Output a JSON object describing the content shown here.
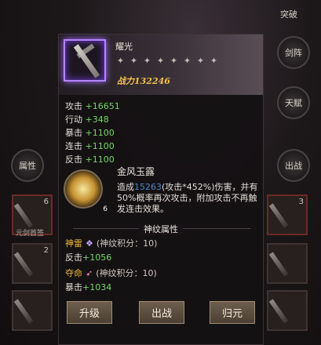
{
  "side_menu": {
    "top_label": "突破",
    "items": [
      {
        "label": "剑阵",
        "icon": "sword-formation-icon"
      },
      {
        "label": "天赋",
        "icon": "talent-icon"
      }
    ],
    "left_label": "属性",
    "right_label": "出战"
  },
  "bg_slots": {
    "left_caption": "元剑首签",
    "counts": [
      "6",
      "2",
      "3"
    ]
  },
  "item": {
    "name": "耀光",
    "star_count": 8,
    "power_label": "战力",
    "power_value": "132246"
  },
  "attributes": [
    {
      "label": "攻击",
      "value": "+16651"
    },
    {
      "label": "行动",
      "value": "+348"
    },
    {
      "label": "暴击",
      "value": "+1100"
    },
    {
      "label": "连击",
      "value": "+1100"
    },
    {
      "label": "反击",
      "value": "+1100"
    }
  ],
  "skill": {
    "name": "金风玉露",
    "level": "6",
    "desc_prefix": "造成",
    "desc_highlight": "15263",
    "desc_rest": "(攻击*452%)伤害，并有50%概率再次攻击，附加攻击不再触发连击效果。"
  },
  "rune_section": {
    "title": "神纹属性",
    "runes": [
      {
        "name": "神雷",
        "score": "(神纹积分：10)",
        "attr_label": "反击",
        "attr_value": "+1056",
        "accent": "#c9a8ff"
      },
      {
        "name": "夺命",
        "score": "(神纹积分：10)",
        "attr_label": "暴击",
        "attr_value": "+1034",
        "accent": "#ff8fb4"
      }
    ]
  },
  "buttons": {
    "upgrade": "升级",
    "deploy": "出战",
    "return": "归元"
  }
}
